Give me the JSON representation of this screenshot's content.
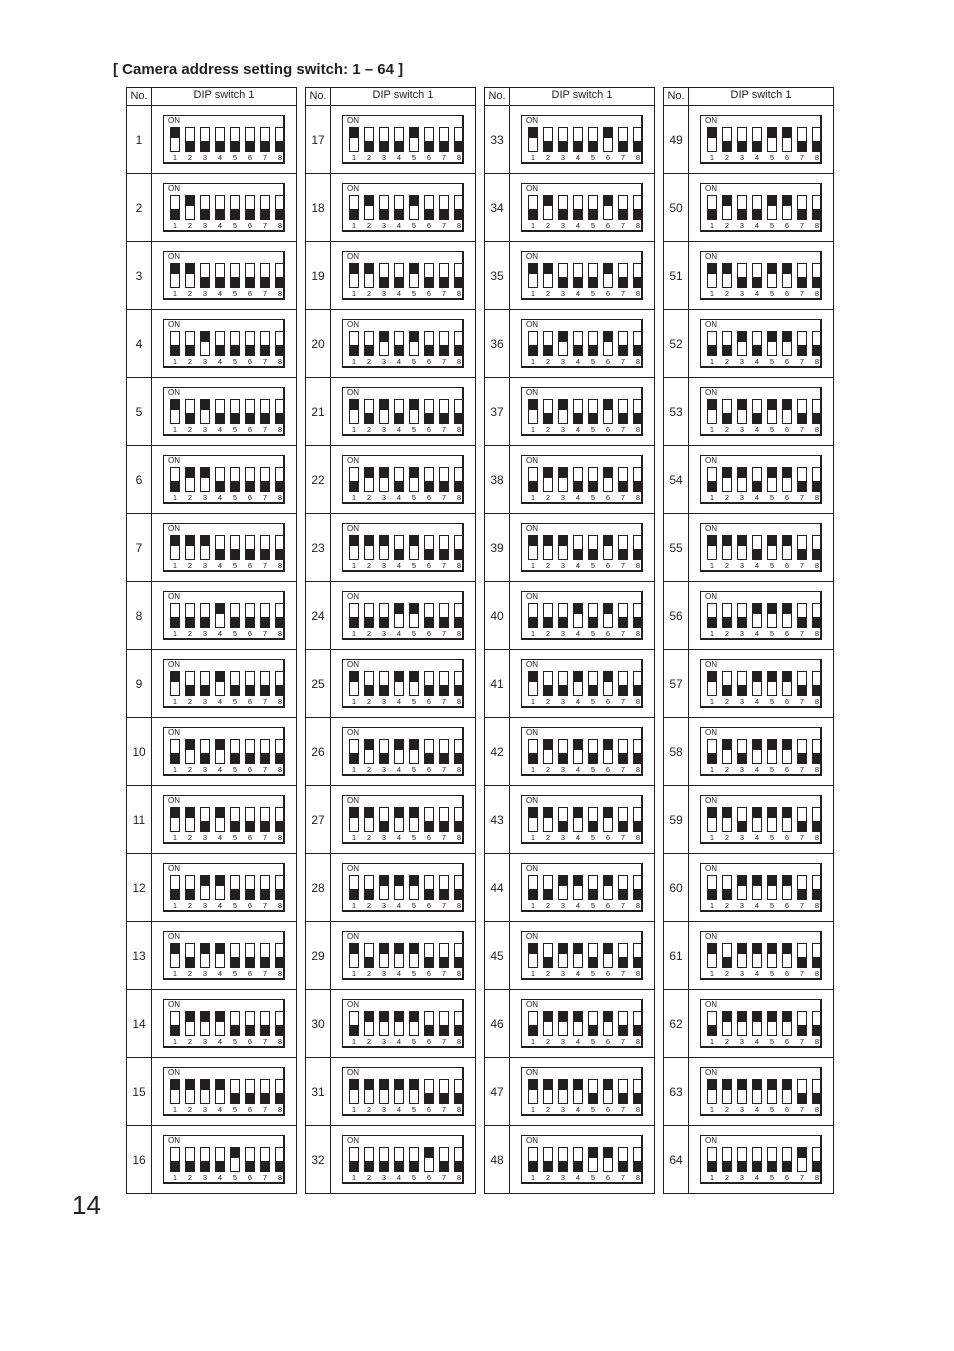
{
  "title": "[ Camera address setting switch: 1 – 64 ]",
  "header": {
    "no": "No.",
    "dip": "DIP switch 1"
  },
  "on_label": "ON",
  "switch_numbers": [
    "1",
    "2",
    "3",
    "4",
    "5",
    "6",
    "7",
    "8"
  ],
  "page_number": "14",
  "cameras": [
    {
      "no": "1",
      "on": [
        1,
        0,
        0,
        0,
        0,
        0,
        0,
        0
      ]
    },
    {
      "no": "2",
      "on": [
        0,
        1,
        0,
        0,
        0,
        0,
        0,
        0
      ]
    },
    {
      "no": "3",
      "on": [
        1,
        1,
        0,
        0,
        0,
        0,
        0,
        0
      ]
    },
    {
      "no": "4",
      "on": [
        0,
        0,
        1,
        0,
        0,
        0,
        0,
        0
      ]
    },
    {
      "no": "5",
      "on": [
        1,
        0,
        1,
        0,
        0,
        0,
        0,
        0
      ]
    },
    {
      "no": "6",
      "on": [
        0,
        1,
        1,
        0,
        0,
        0,
        0,
        0
      ]
    },
    {
      "no": "7",
      "on": [
        1,
        1,
        1,
        0,
        0,
        0,
        0,
        0
      ]
    },
    {
      "no": "8",
      "on": [
        0,
        0,
        0,
        1,
        0,
        0,
        0,
        0
      ]
    },
    {
      "no": "9",
      "on": [
        1,
        0,
        0,
        1,
        0,
        0,
        0,
        0
      ]
    },
    {
      "no": "10",
      "on": [
        0,
        1,
        0,
        1,
        0,
        0,
        0,
        0
      ]
    },
    {
      "no": "11",
      "on": [
        1,
        1,
        0,
        1,
        0,
        0,
        0,
        0
      ]
    },
    {
      "no": "12",
      "on": [
        0,
        0,
        1,
        1,
        0,
        0,
        0,
        0
      ]
    },
    {
      "no": "13",
      "on": [
        1,
        0,
        1,
        1,
        0,
        0,
        0,
        0
      ]
    },
    {
      "no": "14",
      "on": [
        0,
        1,
        1,
        1,
        0,
        0,
        0,
        0
      ]
    },
    {
      "no": "15",
      "on": [
        1,
        1,
        1,
        1,
        0,
        0,
        0,
        0
      ]
    },
    {
      "no": "16",
      "on": [
        0,
        0,
        0,
        0,
        1,
        0,
        0,
        0
      ]
    },
    {
      "no": "17",
      "on": [
        1,
        0,
        0,
        0,
        1,
        0,
        0,
        0
      ]
    },
    {
      "no": "18",
      "on": [
        0,
        1,
        0,
        0,
        1,
        0,
        0,
        0
      ]
    },
    {
      "no": "19",
      "on": [
        1,
        1,
        0,
        0,
        1,
        0,
        0,
        0
      ]
    },
    {
      "no": "20",
      "on": [
        0,
        0,
        1,
        0,
        1,
        0,
        0,
        0
      ]
    },
    {
      "no": "21",
      "on": [
        1,
        0,
        1,
        0,
        1,
        0,
        0,
        0
      ]
    },
    {
      "no": "22",
      "on": [
        0,
        1,
        1,
        0,
        1,
        0,
        0,
        0
      ]
    },
    {
      "no": "23",
      "on": [
        1,
        1,
        1,
        0,
        1,
        0,
        0,
        0
      ]
    },
    {
      "no": "24",
      "on": [
        0,
        0,
        0,
        1,
        1,
        0,
        0,
        0
      ]
    },
    {
      "no": "25",
      "on": [
        1,
        0,
        0,
        1,
        1,
        0,
        0,
        0
      ]
    },
    {
      "no": "26",
      "on": [
        0,
        1,
        0,
        1,
        1,
        0,
        0,
        0
      ]
    },
    {
      "no": "27",
      "on": [
        1,
        1,
        0,
        1,
        1,
        0,
        0,
        0
      ]
    },
    {
      "no": "28",
      "on": [
        0,
        0,
        1,
        1,
        1,
        0,
        0,
        0
      ]
    },
    {
      "no": "29",
      "on": [
        1,
        0,
        1,
        1,
        1,
        0,
        0,
        0
      ]
    },
    {
      "no": "30",
      "on": [
        0,
        1,
        1,
        1,
        1,
        0,
        0,
        0
      ]
    },
    {
      "no": "31",
      "on": [
        1,
        1,
        1,
        1,
        1,
        0,
        0,
        0
      ]
    },
    {
      "no": "32",
      "on": [
        0,
        0,
        0,
        0,
        0,
        1,
        0,
        0
      ]
    },
    {
      "no": "33",
      "on": [
        1,
        0,
        0,
        0,
        0,
        1,
        0,
        0
      ]
    },
    {
      "no": "34",
      "on": [
        0,
        1,
        0,
        0,
        0,
        1,
        0,
        0
      ]
    },
    {
      "no": "35",
      "on": [
        1,
        1,
        0,
        0,
        0,
        1,
        0,
        0
      ]
    },
    {
      "no": "36",
      "on": [
        0,
        0,
        1,
        0,
        0,
        1,
        0,
        0
      ]
    },
    {
      "no": "37",
      "on": [
        1,
        0,
        1,
        0,
        0,
        1,
        0,
        0
      ]
    },
    {
      "no": "38",
      "on": [
        0,
        1,
        1,
        0,
        0,
        1,
        0,
        0
      ]
    },
    {
      "no": "39",
      "on": [
        1,
        1,
        1,
        0,
        0,
        1,
        0,
        0
      ]
    },
    {
      "no": "40",
      "on": [
        0,
        0,
        0,
        1,
        0,
        1,
        0,
        0
      ]
    },
    {
      "no": "41",
      "on": [
        1,
        0,
        0,
        1,
        0,
        1,
        0,
        0
      ]
    },
    {
      "no": "42",
      "on": [
        0,
        1,
        0,
        1,
        0,
        1,
        0,
        0
      ]
    },
    {
      "no": "43",
      "on": [
        1,
        1,
        0,
        1,
        0,
        1,
        0,
        0
      ]
    },
    {
      "no": "44",
      "on": [
        0,
        0,
        1,
        1,
        0,
        1,
        0,
        0
      ]
    },
    {
      "no": "45",
      "on": [
        1,
        0,
        1,
        1,
        0,
        1,
        0,
        0
      ]
    },
    {
      "no": "46",
      "on": [
        0,
        1,
        1,
        1,
        0,
        1,
        0,
        0
      ]
    },
    {
      "no": "47",
      "on": [
        1,
        1,
        1,
        1,
        0,
        1,
        0,
        0
      ]
    },
    {
      "no": "48",
      "on": [
        0,
        0,
        0,
        0,
        1,
        1,
        0,
        0
      ]
    },
    {
      "no": "49",
      "on": [
        1,
        0,
        0,
        0,
        1,
        1,
        0,
        0
      ]
    },
    {
      "no": "50",
      "on": [
        0,
        1,
        0,
        0,
        1,
        1,
        0,
        0
      ]
    },
    {
      "no": "51",
      "on": [
        1,
        1,
        0,
        0,
        1,
        1,
        0,
        0
      ]
    },
    {
      "no": "52",
      "on": [
        0,
        0,
        1,
        0,
        1,
        1,
        0,
        0
      ]
    },
    {
      "no": "53",
      "on": [
        1,
        0,
        1,
        0,
        1,
        1,
        0,
        0
      ]
    },
    {
      "no": "54",
      "on": [
        0,
        1,
        1,
        0,
        1,
        1,
        0,
        0
      ]
    },
    {
      "no": "55",
      "on": [
        1,
        1,
        1,
        0,
        1,
        1,
        0,
        0
      ]
    },
    {
      "no": "56",
      "on": [
        0,
        0,
        0,
        1,
        1,
        1,
        0,
        0
      ]
    },
    {
      "no": "57",
      "on": [
        1,
        0,
        0,
        1,
        1,
        1,
        0,
        0
      ]
    },
    {
      "no": "58",
      "on": [
        0,
        1,
        0,
        1,
        1,
        1,
        0,
        0
      ]
    },
    {
      "no": "59",
      "on": [
        1,
        1,
        0,
        1,
        1,
        1,
        0,
        0
      ]
    },
    {
      "no": "60",
      "on": [
        0,
        0,
        1,
        1,
        1,
        1,
        0,
        0
      ]
    },
    {
      "no": "61",
      "on": [
        1,
        0,
        1,
        1,
        1,
        1,
        0,
        0
      ]
    },
    {
      "no": "62",
      "on": [
        0,
        1,
        1,
        1,
        1,
        1,
        0,
        0
      ]
    },
    {
      "no": "63",
      "on": [
        1,
        1,
        1,
        1,
        1,
        1,
        0,
        0
      ]
    },
    {
      "no": "64",
      "on": [
        0,
        0,
        0,
        0,
        0,
        0,
        1,
        0
      ]
    }
  ]
}
